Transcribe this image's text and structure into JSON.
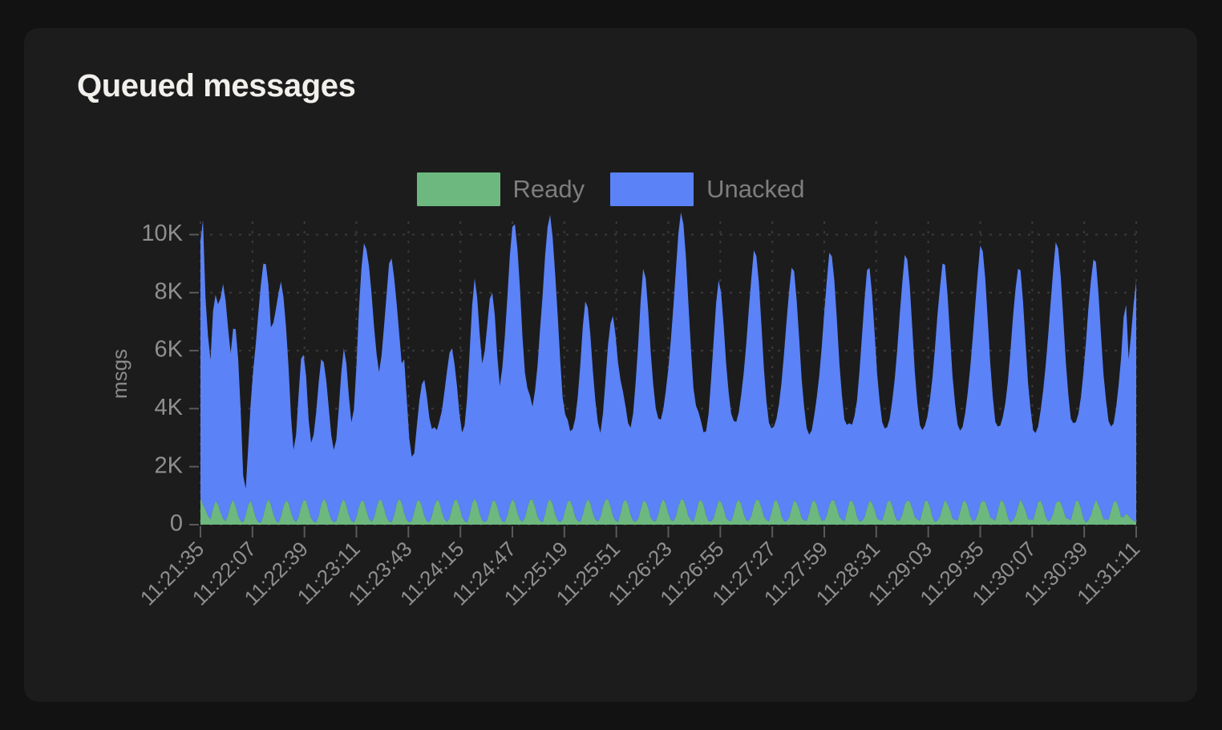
{
  "card": {
    "title": "Queued messages",
    "background": "#1c1c1c",
    "page_background": "#121212"
  },
  "legend": {
    "position": "top-center",
    "items": [
      {
        "label": "Ready",
        "color": "#6db87f",
        "name": "ready"
      },
      {
        "label": "Unacked",
        "color": "#5b82f6",
        "name": "unacked"
      }
    ]
  },
  "chart_data": {
    "type": "area",
    "stacked": true,
    "title": "Queued messages",
    "xlabel": "",
    "ylabel": "msgs",
    "ylim": [
      0,
      10400
    ],
    "ytick_labels": [
      "0",
      "2K",
      "4K",
      "6K",
      "8K",
      "10K"
    ],
    "ytick_values": [
      0,
      2000,
      4000,
      6000,
      8000,
      10000
    ],
    "grid": true,
    "grid_style": "dotted",
    "grid_color": "#3b3b3b",
    "xtick_labels": [
      "11:21:35",
      "11:22:07",
      "11:22:39",
      "11:23:11",
      "11:23:43",
      "11:24:15",
      "11:24:47",
      "11:25:19",
      "11:25:51",
      "11:26:23",
      "11:26:55",
      "11:27:27",
      "11:27:59",
      "11:28:31",
      "11:29:03",
      "11:29:35",
      "11:30:07",
      "11:30:39",
      "11:31:11"
    ],
    "xtick_rotation_deg": -45,
    "x_interval_seconds": 32,
    "x_start": "11:21:35",
    "x_end": "11:31:28",
    "series": [
      {
        "name": "Ready",
        "color": "#6db87f",
        "values": [
          900,
          700,
          520,
          300,
          180,
          560,
          820,
          700,
          420,
          200,
          120,
          360,
          700,
          860,
          640,
          300,
          120,
          80,
          340,
          700,
          820,
          560,
          240,
          90,
          60,
          300,
          680,
          880,
          700,
          360,
          140,
          70,
          280,
          640,
          840,
          760,
          420,
          180,
          90,
          260,
          620,
          860,
          820,
          520,
          220,
          100,
          70,
          300,
          700,
          900,
          780,
          440,
          180,
          80,
          120,
          420,
          760,
          880,
          660,
          320,
          130,
          70,
          260,
          620,
          840,
          800,
          480,
          200,
          90,
          240,
          600,
          860,
          840,
          560,
          250,
          110,
          80,
          320,
          720,
          900,
          760,
          400,
          160,
          80,
          140,
          460,
          780,
          860,
          640,
          300,
          120,
          80,
          300,
          660,
          860,
          780,
          440,
          190,
          90,
          220,
          580,
          840,
          860,
          600,
          270,
          120,
          70,
          340,
          740,
          900,
          740,
          380,
          150,
          80,
          160,
          480,
          800,
          840,
          620,
          280,
          110,
          90,
          320,
          680,
          870,
          760,
          420,
          180,
          100,
          240,
          600,
          850,
          870,
          620,
          280,
          130,
          80,
          360,
          760,
          880,
          720,
          360,
          140,
          90,
          180,
          500,
          810,
          820,
          600,
          260,
          120,
          100,
          340,
          700,
          880,
          740,
          400,
          170,
          110,
          260,
          620,
          860,
          880,
          640,
          300,
          140,
          90,
          380,
          770,
          870,
          700,
          340,
          130,
          100,
          200,
          520,
          820,
          800,
          580,
          240,
          130,
          110,
          360,
          720,
          880,
          720,
          380,
          160,
          120,
          280,
          640,
          870,
          860,
          620,
          290,
          150,
          100,
          400,
          780,
          860,
          680,
          320,
          120,
          110,
          220,
          540,
          830,
          780,
          560,
          230,
          140,
          120,
          380,
          740,
          870,
          700,
          360,
          150,
          130,
          300,
          660,
          860,
          840,
          600,
          280,
          160,
          110,
          420,
          790,
          850,
          660,
          300,
          110,
          120,
          240,
          560,
          840,
          760,
          540,
          220,
          150,
          130,
          400,
          750,
          860,
          680,
          340,
          140,
          140,
          320,
          680,
          850,
          820,
          580,
          270,
          170,
          120,
          440,
          800,
          840,
          640,
          280,
          100,
          130,
          260,
          580,
          850,
          740,
          520,
          210,
          160,
          140,
          420,
          760,
          850,
          660,
          320,
          130,
          150,
          340,
          700,
          840,
          800,
          560,
          260,
          180,
          130,
          460,
          810,
          830,
          620,
          260,
          90,
          140,
          280,
          600,
          860,
          720,
          500,
          200,
          170,
          150,
          440,
          770,
          840,
          640,
          300,
          120,
          160,
          360,
          720,
          830,
          780,
          540,
          250,
          190,
          140,
          480,
          820,
          820,
          600,
          240,
          80,
          150,
          300,
          620,
          870,
          700,
          480,
          190,
          180,
          160,
          460,
          780,
          830,
          620,
          280,
          110,
          170,
          380,
          740,
          820,
          760,
          520,
          240,
          200,
          150,
          500,
          830,
          810,
          580,
          220,
          70,
          160,
          320,
          640,
          860,
          680,
          460,
          180,
          190,
          170,
          480,
          790,
          820,
          600,
          260,
          260,
          380,
          300,
          200,
          140,
          90
        ]
      },
      {
        "name": "Unacked",
        "color": "#5b82f6",
        "values": [
          8900,
          9800,
          7300,
          6200,
          5500,
          6800,
          7100,
          6900,
          7400,
          8100,
          7600,
          6400,
          5200,
          5900,
          6100,
          5400,
          3800,
          1600,
          900,
          2000,
          3400,
          4800,
          6000,
          7200,
          8200,
          8700,
          8300,
          7400,
          6100,
          6600,
          7300,
          7900,
          8100,
          7200,
          6000,
          4700,
          3300,
          2400,
          3000,
          4200,
          5100,
          5000,
          4300,
          3100,
          2600,
          3000,
          3800,
          4600,
          5000,
          4700,
          4200,
          3600,
          2900,
          2500,
          2800,
          3600,
          4500,
          5200,
          4900,
          4100,
          3400,
          3900,
          5200,
          6800,
          8000,
          8900,
          9000,
          8700,
          7900,
          6600,
          5300,
          4400,
          5000,
          6300,
          7700,
          8900,
          9100,
          8200,
          6900,
          5700,
          4800,
          5300,
          4200,
          2900,
          2200,
          2000,
          2600,
          3400,
          4200,
          4700,
          4300,
          3600,
          3000,
          2700,
          2400,
          2800,
          3500,
          4400,
          5200,
          5700,
          5500,
          4700,
          3900,
          3200,
          2900,
          3300,
          4300,
          5600,
          6800,
          7600,
          7100,
          6200,
          5400,
          5900,
          6700,
          7300,
          7200,
          6400,
          5200,
          4500,
          5300,
          6400,
          7500,
          8600,
          9400,
          9600,
          9100,
          8000,
          6400,
          5000,
          4100,
          3600,
          3200,
          4000,
          5200,
          6600,
          7800,
          8900,
          9500,
          9800,
          9200,
          8300,
          7100,
          5600,
          4200,
          3300,
          2800,
          2400,
          2700,
          3400,
          4300,
          5400,
          6500,
          7000,
          6600,
          5800,
          4900,
          4100,
          3400,
          2900,
          3200,
          4100,
          5300,
          6300,
          6900,
          6400,
          5500,
          4600,
          3800,
          3200,
          2800,
          3000,
          3700,
          4800,
          6000,
          7200,
          8000,
          7700,
          6800,
          5700,
          4700,
          3900,
          3300,
          2900,
          3100,
          3900,
          5000,
          6200,
          7400,
          8500,
          9400,
          9900,
          9500,
          8600,
          7300,
          5900,
          4600,
          3700,
          3100,
          2700,
          2500,
          2900,
          3700,
          4900,
          6100,
          7100,
          7600,
          7200,
          6300,
          5300,
          4400,
          3700,
          3200,
          2800,
          3000,
          3800,
          4900,
          6100,
          7300,
          8200,
          8800,
          8400,
          7500,
          6300,
          5100,
          4100,
          3400,
          2900,
          2600,
          2800,
          3500,
          4600,
          5800,
          6900,
          7800,
          8300,
          7900,
          7000,
          5900,
          4800,
          3900,
          3200,
          2700,
          2500,
          2900,
          3700,
          4800,
          6000,
          7200,
          8100,
          8700,
          8400,
          7600,
          6500,
          5300,
          4300,
          3500,
          3000,
          2700,
          2600,
          3100,
          4000,
          5200,
          6400,
          7500,
          8200,
          8000,
          7200,
          6100,
          5000,
          4100,
          3400,
          2900,
          2600,
          2800,
          3600,
          4700,
          5900,
          7100,
          8000,
          8600,
          8300,
          7400,
          6200,
          5000,
          4000,
          3300,
          2800,
          2600,
          2900,
          3700,
          4800,
          6000,
          7100,
          7900,
          8400,
          8100,
          7200,
          6000,
          4900,
          4000,
          3300,
          2800,
          2600,
          3000,
          3900,
          5100,
          6300,
          7400,
          8300,
          8900,
          8600,
          7700,
          6500,
          5300,
          4200,
          3400,
          2900,
          2600,
          2900,
          3600,
          4700,
          5900,
          7000,
          7800,
          8200,
          7900,
          7000,
          5800,
          4700,
          3800,
          3100,
          2700,
          2600,
          3100,
          4000,
          5200,
          6400,
          7500,
          8400,
          9000,
          8700,
          7800,
          6600,
          5400,
          4300,
          3500,
          3000,
          2700,
          3000,
          3800,
          5000,
          6200,
          7300,
          8100,
          8500,
          8200,
          7300,
          6100,
          5000,
          4100,
          3400,
          2900,
          2700,
          3200,
          4200,
          5500,
          6900,
          7200,
          5400,
          6400,
          7500,
          8300
        ]
      }
    ]
  }
}
